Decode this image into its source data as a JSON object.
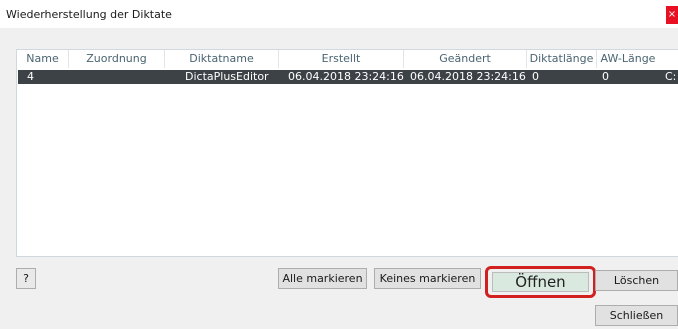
{
  "window": {
    "title": "Wiederherstellung der Diktate",
    "close_glyph": "×"
  },
  "columns": [
    "Name",
    "Zuordnung",
    "Diktatname",
    "Erstellt",
    "Geändert",
    "Diktatlänge",
    "AW-Länge"
  ],
  "rows": [
    {
      "name": "4",
      "zuordnung": "",
      "diktatname": "DictaPlusEditor",
      "erstellt": "06.04.2018 23:24:16",
      "geaendert": "06.04.2018 23:24:16",
      "diktatlaenge": "0",
      "aw_laenge": "0",
      "overflow": "C:"
    }
  ],
  "scrollbar": {
    "left_arrow": "‹",
    "right_arrow": "›"
  },
  "buttons": {
    "help": "?",
    "select_all": "Alle markieren",
    "select_none": "Keines markieren",
    "open": "Öffnen",
    "delete": "Löschen",
    "close": "Schließen"
  },
  "colors": {
    "highlight_border": "#d21f1f",
    "selected_row": "#3c4246",
    "close_button": "#e81123"
  }
}
